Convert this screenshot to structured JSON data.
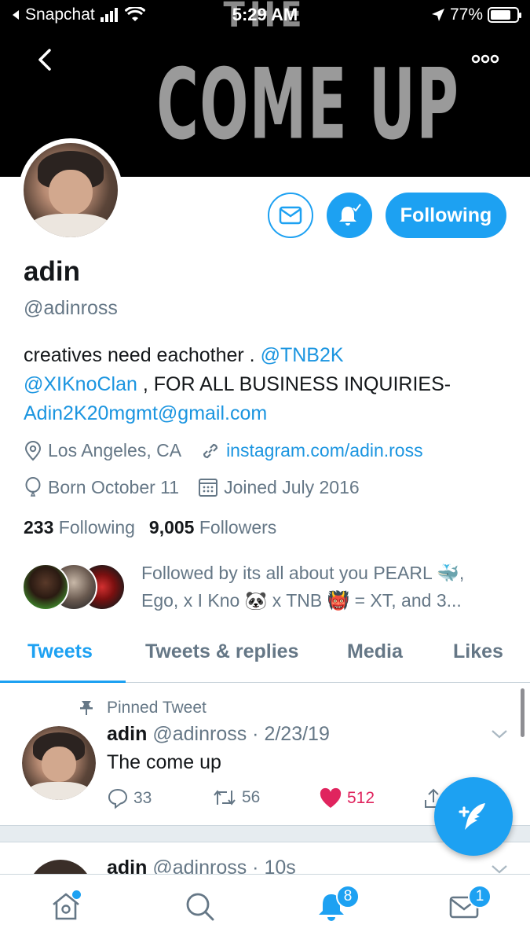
{
  "status_bar": {
    "back_app": "Snapchat",
    "time": "5:29 AM",
    "battery": "77%",
    "battery_level": 0.77
  },
  "banner": {
    "small_text": "THE",
    "title": "COME UP"
  },
  "profile": {
    "name": "adin",
    "handle": "@adinross",
    "follow_button": "Following",
    "bio": {
      "part1": "creatives need eachother . ",
      "mention1": "@TNB2K",
      "mention2": "@XIKnoClan",
      "part2": " , FOR ALL BUSINESS INQUIRIES-",
      "email": "Adin2K20mgmt@gmail.com"
    },
    "location": "Los Angeles, CA",
    "website": "instagram.com/adin.ross",
    "birthday": "Born October 11",
    "joined": "Joined July 2016",
    "following_count": "233",
    "following_label": "Following",
    "followers_count": "9,005",
    "followers_label": "Followers",
    "followed_by": "Followed by its all about you PEARL 🐳, Ego, x I Kno 🐼 x TNB 👹 = XT, and 3..."
  },
  "tabs": [
    {
      "label": "Tweets",
      "active": true
    },
    {
      "label": "Tweets & replies",
      "active": false
    },
    {
      "label": "Media",
      "active": false
    },
    {
      "label": "Likes",
      "active": false
    }
  ],
  "pinned_tweet": {
    "pinned_label": "Pinned Tweet",
    "name": "adin",
    "handle_date": "@adinross · 2/23/19",
    "text": "The come up",
    "replies": "33",
    "retweets": "56",
    "likes": "512"
  },
  "next_tweet": {
    "name": "adin",
    "handle_date": "@adinross · 10s"
  },
  "bottom_nav": {
    "notifications_badge": "8",
    "messages_badge": "1"
  },
  "colors": {
    "accent": "#1da1f2",
    "like": "#e0245e",
    "secondary_text": "#657786"
  }
}
